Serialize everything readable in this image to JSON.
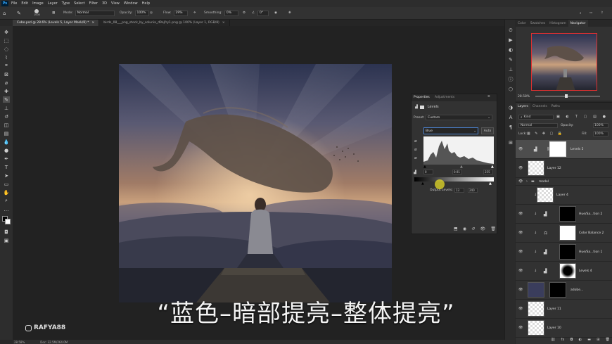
{
  "menu": {
    "app_icon": "Ps",
    "items": [
      "File",
      "Edit",
      "Image",
      "Layer",
      "Type",
      "Select",
      "Filter",
      "3D",
      "View",
      "Window",
      "Help"
    ]
  },
  "options": {
    "brush_size": "1000",
    "mode_label": "Mode:",
    "mode_value": "Normal",
    "opacity_label": "Opacity:",
    "opacity_value": "100%",
    "flow_label": "Flow:",
    "flow_value": "29%",
    "smoothing_label": "Smoothing:",
    "smoothing_value": "0%",
    "angle_value": "0°"
  },
  "tabs": [
    {
      "label": "Cobo.psd @ 28.6% (Levels 5, Layer Mask/8) *"
    },
    {
      "label": "birds_08___png_stock_by_solunia_d9ojfry1.png @ 100% (Layer 1, RGB/8)"
    }
  ],
  "caption": "“蓝色–暗部提亮–整体提亮”",
  "watermark": "RAFYA88",
  "status": {
    "zoom": "28.58%",
    "doc": "Doc: 32.5M/264.0M"
  },
  "properties": {
    "tab_properties": "Properties",
    "tab_adjustments": "Adjustments",
    "adjustment_name": "Levels",
    "preset_label": "Preset:",
    "preset_value": "Custom",
    "channel_value": "Blue",
    "auto_label": "Auto",
    "input_black": "0",
    "input_gamma": "0.91",
    "input_white": "255",
    "output_label": "Output Levels:",
    "output_black": "13",
    "output_white": "240"
  },
  "navigator": {
    "tabs": [
      "Color",
      "Swatches",
      "Histogram",
      "Navigator"
    ],
    "active_tab": "Navigator",
    "zoom": "28.58%"
  },
  "layers": {
    "tabs": [
      "Layers",
      "Channels",
      "Paths"
    ],
    "active_tab": "Layers",
    "kind_label": "Kind",
    "blend_mode": "Normal",
    "opacity_label": "Opacity:",
    "opacity_value": "100%",
    "lock_label": "Lock:",
    "fill_label": "Fill:",
    "fill_value": "100%",
    "rows": [
      {
        "name": "Levels 5"
      },
      {
        "name": "Layer 12"
      },
      {
        "name": "model"
      },
      {
        "name": "Layer 4"
      },
      {
        "name": "Hue/Sa...tion 2"
      },
      {
        "name": "Color Balance 2"
      },
      {
        "name": "Hue/Sa...tion 1"
      },
      {
        "name": "Levels 4"
      },
      {
        "name": "adobe..."
      },
      {
        "name": "Layer 11"
      },
      {
        "name": "Layer 10"
      }
    ]
  }
}
